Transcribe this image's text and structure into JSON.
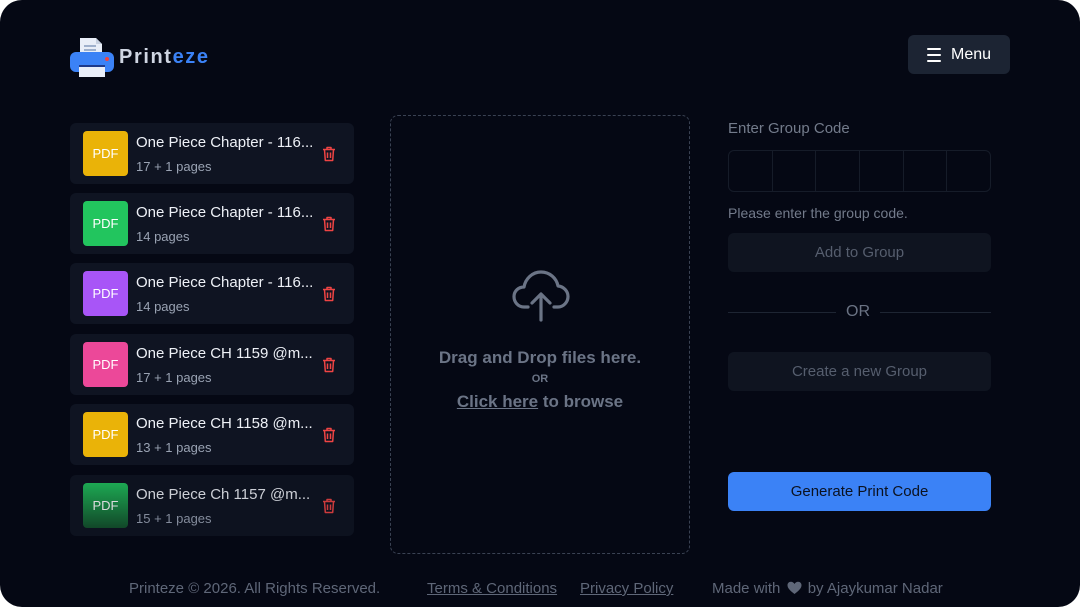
{
  "brand": {
    "name_part1": "Print",
    "name_part2": "eze",
    "accent": "#3b82f6",
    "icon": "printer-icon"
  },
  "header": {
    "menu_label": "Menu",
    "menu_icon": "hamburger-icon"
  },
  "files": [
    {
      "name": "One Piece Chapter - 116...",
      "pages": "17 + 1 pages",
      "badge": "PDF",
      "color": "#eab308"
    },
    {
      "name": "One Piece Chapter - 116...",
      "pages": "14 pages",
      "badge": "PDF",
      "color": "#22c55e"
    },
    {
      "name": "One Piece Chapter - 116...",
      "pages": "14 pages",
      "badge": "PDF",
      "color": "#a855f7"
    },
    {
      "name": "One Piece CH 1159 @m...",
      "pages": "17 + 1 pages",
      "badge": "PDF",
      "color": "#ec4899"
    },
    {
      "name": "One Piece CH 1158 @m...",
      "pages": "13 + 1 pages",
      "badge": "PDF",
      "color": "#eab308"
    },
    {
      "name": "One Piece Ch 1157 @m...",
      "pages": "15 + 1 pages",
      "badge": "PDF",
      "color": "#22c55e"
    }
  ],
  "dropzone": {
    "icon": "cloud-upload-icon",
    "main": "Drag and Drop files here.",
    "or": "OR",
    "browse_link": "Click here",
    "browse_rest": " to browse"
  },
  "group": {
    "label": "Enter Group Code",
    "code_length": 6,
    "hint": "Please enter the group code.",
    "add_button": "Add to Group",
    "or": "OR",
    "create_button": "Create a new Group"
  },
  "generate_button": "Generate Print Code",
  "footer": {
    "copyright": "Printeze © 2026. All Rights Reserved.",
    "terms": "Terms & Conditions",
    "privacy": "Privacy Policy",
    "made_with": "Made with",
    "by": "by Ajaykumar Nadar"
  }
}
